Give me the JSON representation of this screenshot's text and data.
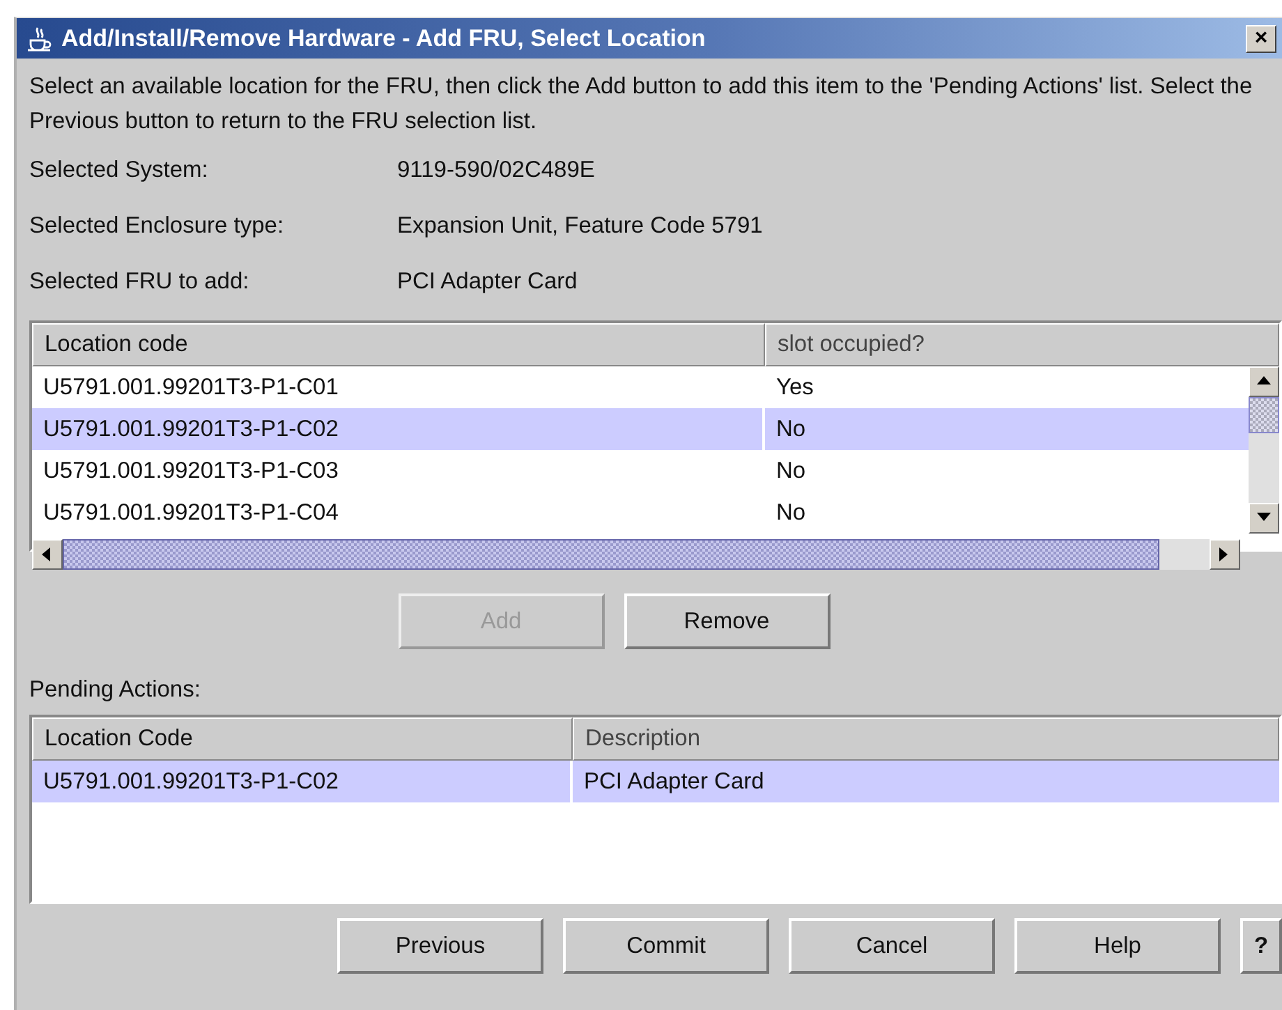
{
  "window": {
    "title": "Add/Install/Remove Hardware - Add FRU, Select Location",
    "close": "×"
  },
  "instructions": "Select an available location for the FRU, then click the Add button to add this item to the 'Pending Actions' list. Select the Previous button to return to the FRU selection list.",
  "info": [
    {
      "label": "Selected System:",
      "value": "9119-590/02C489E"
    },
    {
      "label": "Selected Enclosure type:",
      "value": "Expansion Unit, Feature Code 5791"
    },
    {
      "label": "Selected FRU to add:",
      "value": "PCI Adapter Card"
    }
  ],
  "locations": {
    "columns": [
      "Location code",
      "slot occupied?"
    ],
    "rows": [
      {
        "cells": [
          "U5791.001.99201T3-P1-C01",
          "Yes"
        ],
        "selected": false
      },
      {
        "cells": [
          "U5791.001.99201T3-P1-C02",
          "No"
        ],
        "selected": true
      },
      {
        "cells": [
          "U5791.001.99201T3-P1-C03",
          "No"
        ],
        "selected": false
      },
      {
        "cells": [
          "U5791.001.99201T3-P1-C04",
          "No"
        ],
        "selected": false
      }
    ]
  },
  "list_buttons": [
    {
      "label": "Add",
      "disabled": true
    },
    {
      "label": "Remove",
      "disabled": false
    }
  ],
  "pending": {
    "label": "Pending Actions:",
    "columns": [
      "Location Code",
      "Description"
    ],
    "rows": [
      {
        "cells": [
          "U5791.001.99201T3-P1-C02",
          "PCI Adapter Card"
        ],
        "selected": true
      }
    ]
  },
  "footer_buttons": [
    {
      "label": "Previous",
      "kind": "normal"
    },
    {
      "label": "Commit",
      "kind": "normal"
    },
    {
      "label": "Cancel",
      "kind": "normal"
    },
    {
      "label": "Help",
      "kind": "normal"
    },
    {
      "label": "?",
      "kind": "small"
    }
  ]
}
